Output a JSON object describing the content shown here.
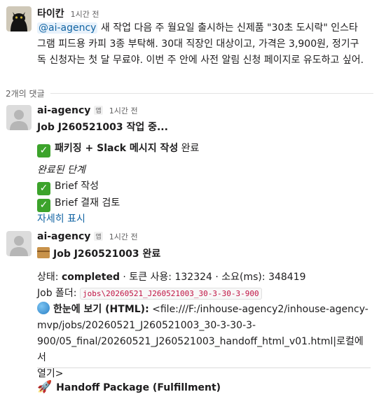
{
  "root_message": {
    "author": "타이칸",
    "time": "1시간 전",
    "mention": "@ai-agency",
    "text": " 새 작업 다음 주 월요일 출시하는 신제품 \"30초 도시락\" 인스타그램 피드용 카피 3종 부탁해. 30대 직장인 대상이고, 가격은 3,900원, 정기구독 신청자는 첫 달 무료야. 이번 주 안에 사전 알림 신청 페이지로 유도하고 싶어."
  },
  "thread": {
    "replies_label": "2개의 댓글"
  },
  "reply1": {
    "author": "ai-agency",
    "badge": "앱",
    "time": "1시간 전",
    "title": "Job J260521003 작업 중...",
    "step_bold": "패키징 + Slack 메시지 작성",
    "step_rest": " 완료",
    "done_heading": "완료된 단계",
    "done_steps": [
      "Brief 작성",
      "Brief 결재 검토"
    ],
    "more_link": "자세히 표시"
  },
  "reply2": {
    "author": "ai-agency",
    "badge": "앱",
    "time": "1시간 전",
    "title": "Job J260521003 완료",
    "status_label": "상태: ",
    "status_value": "completed",
    "tokens_label": " · 토큰 사용: ",
    "tokens_value": "132324",
    "duration_label": " · 소요(ms): ",
    "duration_value": "348419",
    "folder_label": "Job 폴더: ",
    "folder_value": "jobs\\20260521_J260521003_30-3-30-3-900",
    "view_label": "한눈에 보기 (HTML):",
    "view_value_line1": "<file:///F:/inhouse-agency2/inhouse-agency-",
    "view_value_line2": "mvp/jobs/20260521_J260521003_30-3-30-3-",
    "view_value_line3": "900/05_final/20260521_J260521003_handoff_html_v01.html|로컬에서",
    "view_value_line4": "열기>",
    "handoff": "Handoff Package (Fulfillment)"
  }
}
